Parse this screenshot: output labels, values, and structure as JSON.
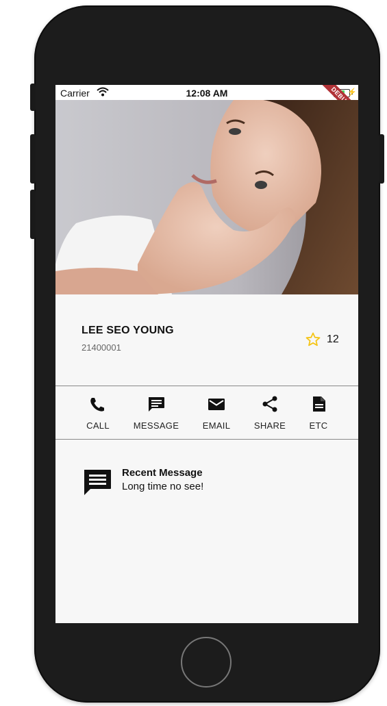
{
  "status_bar": {
    "carrier": "Carrier",
    "time": "12:08 AM",
    "debug_banner": "DEBUG"
  },
  "profile": {
    "name": "LEE SEO YOUNG",
    "id": "21400001",
    "favorite_count": "12",
    "star_color": "#f5c518"
  },
  "actions": [
    {
      "label": "CALL",
      "icon": "phone-icon"
    },
    {
      "label": "MESSAGE",
      "icon": "message-icon"
    },
    {
      "label": "EMAIL",
      "icon": "email-icon"
    },
    {
      "label": "SHARE",
      "icon": "share-icon"
    },
    {
      "label": "ETC",
      "icon": "document-icon"
    }
  ],
  "recent": {
    "title": "Recent Message",
    "body": "Long time no see!",
    "icon": "chat-icon"
  }
}
